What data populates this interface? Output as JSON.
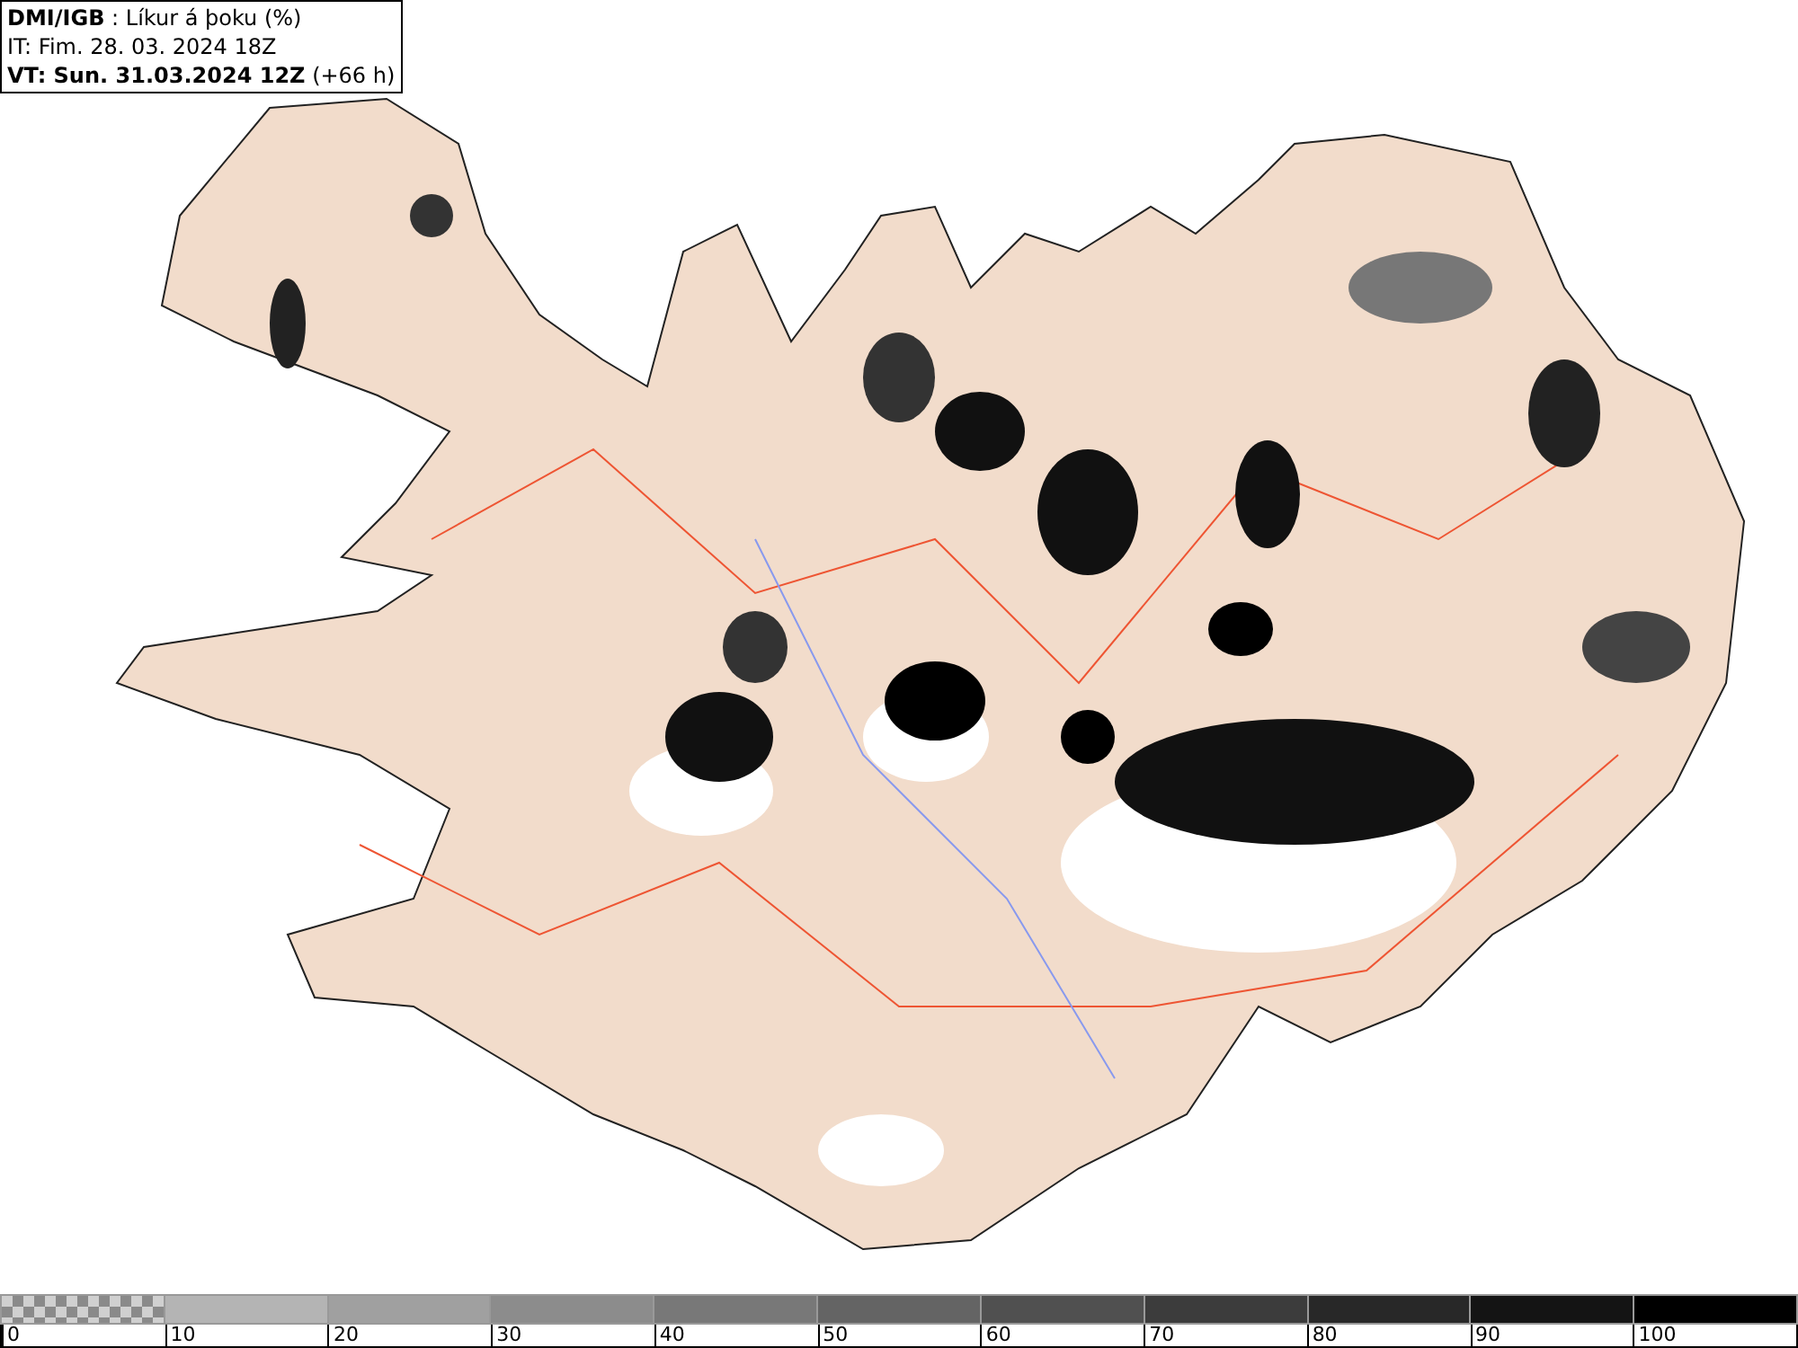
{
  "header": {
    "lines": [
      "**DMI/IGB** : Líkur á þoku (%)",
      "IT: Fim. 28. 03. 2024 18Z",
      "**VT: Sun. 31.03.2024 12Z** (+66 h)"
    ]
  },
  "legend": {
    "bins": [
      {
        "kind": "checker",
        "color": "#8a8a8a"
      },
      {
        "kind": "solid",
        "color": "#b4b4b4"
      },
      {
        "kind": "solid",
        "color": "#a0a0a0"
      },
      {
        "kind": "solid",
        "color": "#8c8c8c"
      },
      {
        "kind": "solid",
        "color": "#787878"
      },
      {
        "kind": "solid",
        "color": "#646464"
      },
      {
        "kind": "solid",
        "color": "#505050"
      },
      {
        "kind": "solid",
        "color": "#3c3c3c"
      },
      {
        "kind": "solid",
        "color": "#282828"
      },
      {
        "kind": "solid",
        "color": "#141414"
      },
      {
        "kind": "solid",
        "color": "#000000"
      }
    ],
    "ticks": [
      "0",
      "10",
      "20",
      "30",
      "40",
      "50",
      "60",
      "70",
      "80",
      "90",
      "100"
    ]
  }
}
